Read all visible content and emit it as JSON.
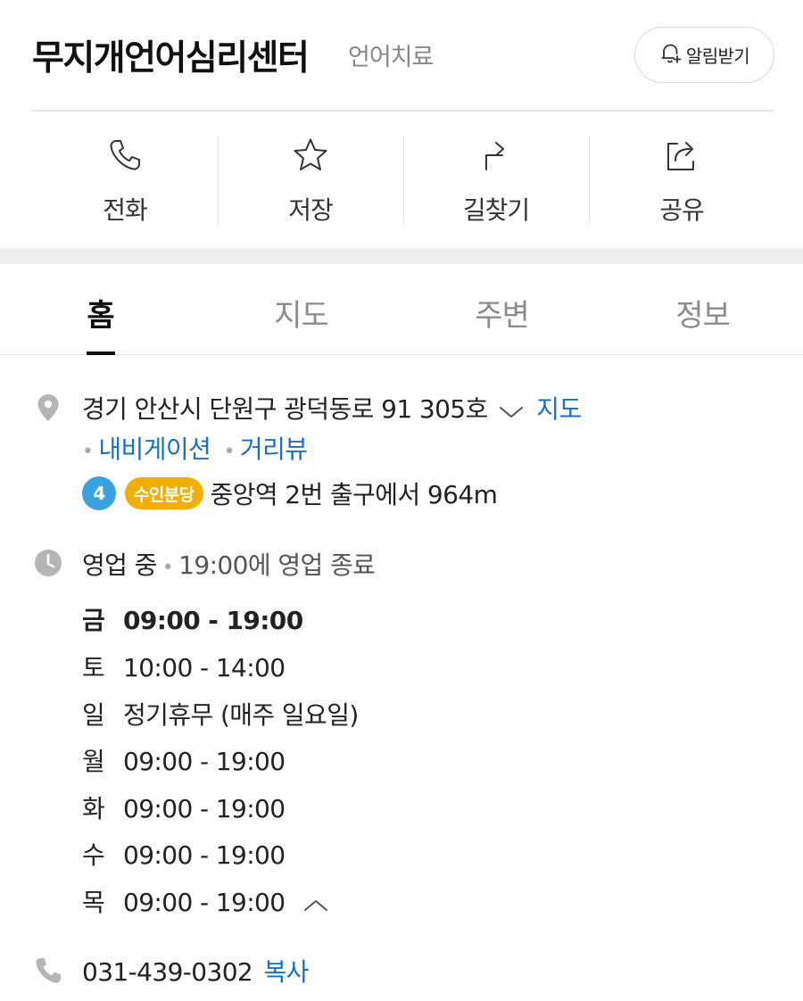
{
  "place": {
    "name": "무지개언어심리센터",
    "category": "언어치료",
    "alarm_label": "알림받기"
  },
  "actions": [
    {
      "label": "전화",
      "icon": "phone-icon"
    },
    {
      "label": "저장",
      "icon": "star-icon"
    },
    {
      "label": "길찾기",
      "icon": "directions-icon"
    },
    {
      "label": "공유",
      "icon": "share-icon"
    }
  ],
  "tabs": [
    {
      "label": "홈",
      "active": true
    },
    {
      "label": "지도",
      "active": false
    },
    {
      "label": "주변",
      "active": false
    },
    {
      "label": "정보",
      "active": false
    }
  ],
  "address": {
    "text": "경기 안산시 단원구 광덕동로 91 305호",
    "map_link": "지도",
    "navigation_link": "내비게이션",
    "roadview_link": "거리뷰"
  },
  "subway": {
    "line_number": "4",
    "line_name": "수인분당",
    "line_number_color": "#3aa2df",
    "line_name_color": "#f1b000",
    "text": "중앙역 2번 출구에서 964m"
  },
  "business": {
    "status": "영업 중",
    "status_detail": "19:00에 영업 종료",
    "hours": [
      {
        "day": "금",
        "time": "09:00 - 19:00",
        "today": true
      },
      {
        "day": "토",
        "time": "10:00 - 14:00",
        "today": false
      },
      {
        "day": "일",
        "time": "정기휴무 (매주 일요일)",
        "today": false
      },
      {
        "day": "월",
        "time": "09:00 - 19:00",
        "today": false
      },
      {
        "day": "화",
        "time": "09:00 - 19:00",
        "today": false
      },
      {
        "day": "수",
        "time": "09:00 - 19:00",
        "today": false
      },
      {
        "day": "목",
        "time": "09:00 - 19:00",
        "today": false
      }
    ]
  },
  "phone": {
    "number": "031-439-0302",
    "copy_label": "복사"
  },
  "colors": {
    "link_blue": "#1a6fc4",
    "icon_gray": "#b5b5b5"
  }
}
